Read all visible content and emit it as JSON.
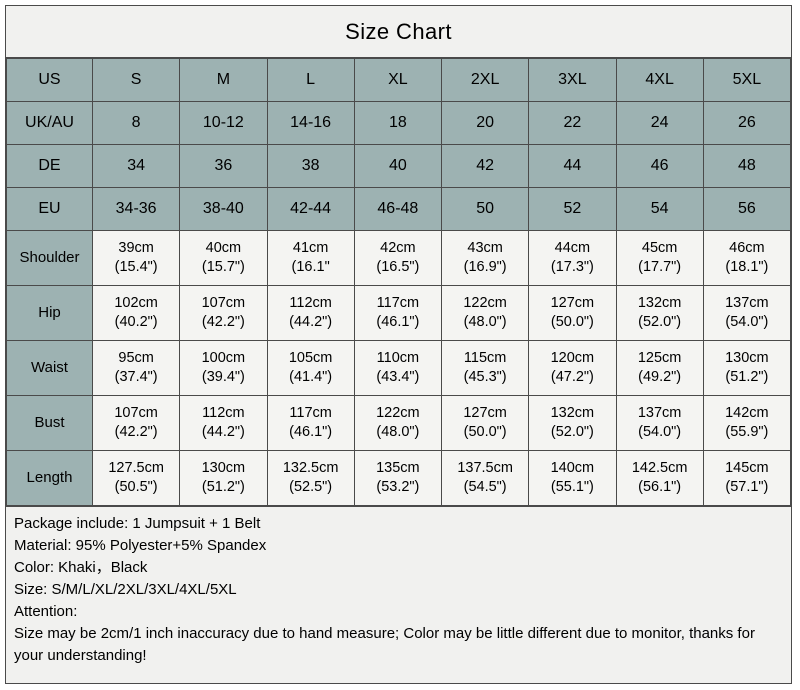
{
  "title": "Size Chart",
  "table": {
    "size_rows": [
      {
        "label": "US",
        "values": [
          "S",
          "M",
          "L",
          "XL",
          "2XL",
          "3XL",
          "4XL",
          "5XL"
        ]
      },
      {
        "label": "UK/AU",
        "values": [
          "8",
          "10-12",
          "14-16",
          "18",
          "20",
          "22",
          "24",
          "26"
        ]
      },
      {
        "label": "DE",
        "values": [
          "34",
          "36",
          "38",
          "40",
          "42",
          "44",
          "46",
          "48"
        ]
      },
      {
        "label": "EU",
        "values": [
          "34-36",
          "38-40",
          "42-44",
          "46-48",
          "50",
          "52",
          "54",
          "56"
        ]
      }
    ],
    "measure_rows": [
      {
        "label": "Shoulder",
        "cm": [
          "39cm",
          "40cm",
          "41cm",
          "42cm",
          "43cm",
          "44cm",
          "45cm",
          "46cm"
        ],
        "inch": [
          "(15.4\")",
          "(15.7\")",
          "(16.1\"",
          "(16.5\")",
          "(16.9\")",
          "(17.3\")",
          "(17.7\")",
          "(18.1\")"
        ]
      },
      {
        "label": "Hip",
        "cm": [
          "102cm",
          "107cm",
          "112cm",
          "117cm",
          "122cm",
          "127cm",
          "132cm",
          "137cm"
        ],
        "inch": [
          "(40.2\")",
          "(42.2\")",
          "(44.2\")",
          "(46.1\")",
          "(48.0\")",
          "(50.0\")",
          "(52.0\")",
          "(54.0\")"
        ]
      },
      {
        "label": "Waist",
        "cm": [
          "95cm",
          "100cm",
          "105cm",
          "110cm",
          "115cm",
          "120cm",
          "125cm",
          "130cm"
        ],
        "inch": [
          "(37.4\")",
          "(39.4\")",
          "(41.4\")",
          "(43.4\")",
          "(45.3\")",
          "(47.2\")",
          "(49.2\")",
          "(51.2\")"
        ]
      },
      {
        "label": "Bust",
        "cm": [
          "107cm",
          "112cm",
          "117cm",
          "122cm",
          "127cm",
          "132cm",
          "137cm",
          "142cm"
        ],
        "inch": [
          "(42.2\")",
          "(44.2\")",
          "(46.1\")",
          "(48.0\")",
          "(50.0\")",
          "(52.0\")",
          "(54.0\")",
          "(55.9\")"
        ]
      },
      {
        "label": "Length",
        "cm": [
          "127.5cm",
          "130cm",
          "132.5cm",
          "135cm",
          "137.5cm",
          "140cm",
          "142.5cm",
          "145cm"
        ],
        "inch": [
          "(50.5\")",
          "(51.2\")",
          "(52.5\")",
          "(53.2\")",
          "(54.5\")",
          "(55.1\")",
          "(56.1\")",
          "(57.1\")"
        ]
      }
    ]
  },
  "notes": {
    "package": "Package include: 1 Jumpsuit + 1 Belt",
    "material": "Material: 95% Polyester+5% Spandex",
    "color": "Color: Khaki，Black",
    "size": "Size: S/M/L/XL/2XL/3XL/4XL/5XL",
    "attention_label": "Attention:",
    "attention_body": "Size may be 2cm/1 inch inaccuracy due to hand measure; Color may be little different due to monitor, thanks for your understanding!"
  },
  "colors": {
    "teal_header": "#9db2b2",
    "cell_bg": "#f4f4f2",
    "panel_bg": "#f1f1ef",
    "border": "#4a4a4a"
  }
}
